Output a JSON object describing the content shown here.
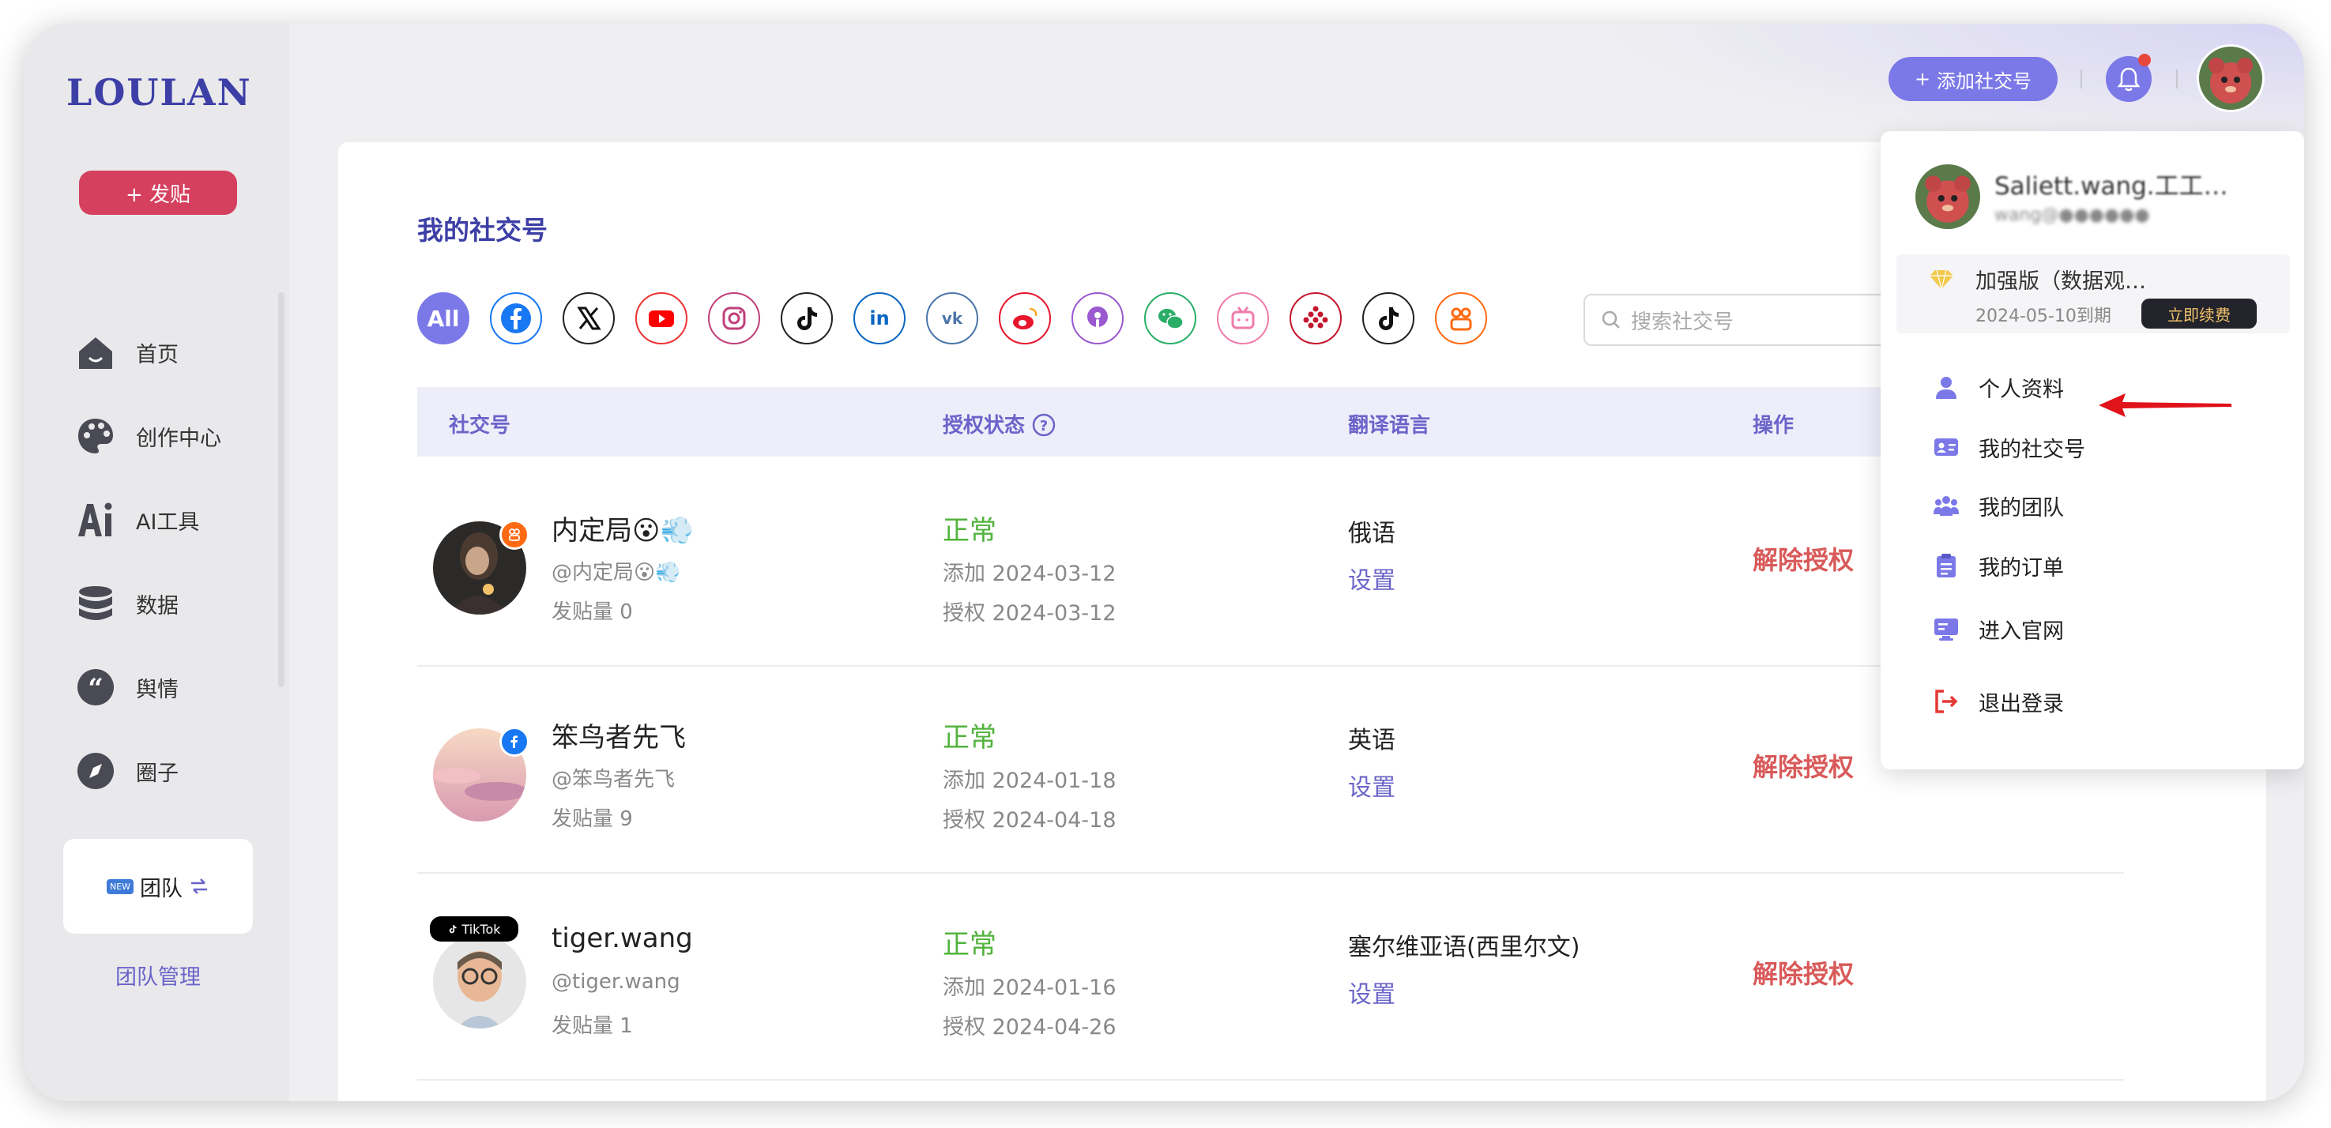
{
  "brand": {
    "logo": "LOULAN",
    "accent": "#7b78e8",
    "primary": "#3d3fa6",
    "danger": "#d6405f"
  },
  "sidebar": {
    "post_label": "+ 发贴",
    "items": [
      {
        "label": "首页",
        "icon": "home-icon"
      },
      {
        "label": "创作中心",
        "icon": "palette-icon"
      },
      {
        "label": "AI工具",
        "icon": "ai-icon"
      },
      {
        "label": "数据",
        "icon": "database-icon"
      },
      {
        "label": "舆情",
        "icon": "quote-icon"
      },
      {
        "label": "圈子",
        "icon": "compass-icon"
      }
    ],
    "team_badge": "NEW",
    "team_label": "团队",
    "team_manage": "团队管理"
  },
  "topbar": {
    "add_label": "添加社交号"
  },
  "main": {
    "title": "我的社交号",
    "filter_all": "All",
    "platforms": [
      "facebook",
      "x",
      "youtube",
      "instagram",
      "tiktok",
      "linkedin",
      "vk",
      "weibo",
      "podcast",
      "wechat",
      "bilibili",
      "dots",
      "tiktok",
      "kuaishou"
    ],
    "search_placeholder": "搜索社交号",
    "columns": {
      "account": "社交号",
      "status": "授权状态",
      "language": "翻译语言",
      "action": "操作"
    },
    "rows": [
      {
        "name": "内定局😮💨",
        "handle": "@内定局😮💨",
        "posts": "发贴量 0",
        "status": "正常",
        "added": "添加 2024-03-12",
        "authorized": "授权 2024-03-12",
        "language": "俄语",
        "set": "设置",
        "action": "解除授权",
        "platform": "kuaishou"
      },
      {
        "name": "笨鸟者先飞",
        "handle": "@笨鸟者先飞",
        "posts": "发贴量 9",
        "status": "正常",
        "added": "添加 2024-01-18",
        "authorized": "授权 2024-04-18",
        "language": "英语",
        "set": "设置",
        "action": "解除授权",
        "platform": "facebook"
      },
      {
        "name": "tiger.wang",
        "handle": "@tiger.wang",
        "posts": "发贴量 1",
        "status": "正常",
        "added": "添加 2024-01-16",
        "authorized": "授权 2024-04-26",
        "language": "塞尔维亚语(西里尔文)",
        "set": "设置",
        "action": "解除授权",
        "platform": "tiktok",
        "platform_tag": "TikTok"
      }
    ]
  },
  "dropdown": {
    "user_name": "Saliett.wang.工工…",
    "user_email": "wang@●●●●●●",
    "plan_name": "加强版（数据观…",
    "plan_expiry": "2024-05-10到期",
    "renew_label": "立即续费",
    "items": [
      {
        "label": "个人资料",
        "icon": "user-icon"
      },
      {
        "label": "我的社交号",
        "icon": "id-card-icon"
      },
      {
        "label": "我的团队",
        "icon": "team-icon"
      },
      {
        "label": "我的订单",
        "icon": "clipboard-icon"
      },
      {
        "label": "进入官网",
        "icon": "monitor-icon"
      },
      {
        "label": "退出登录",
        "icon": "logout-icon"
      }
    ]
  }
}
